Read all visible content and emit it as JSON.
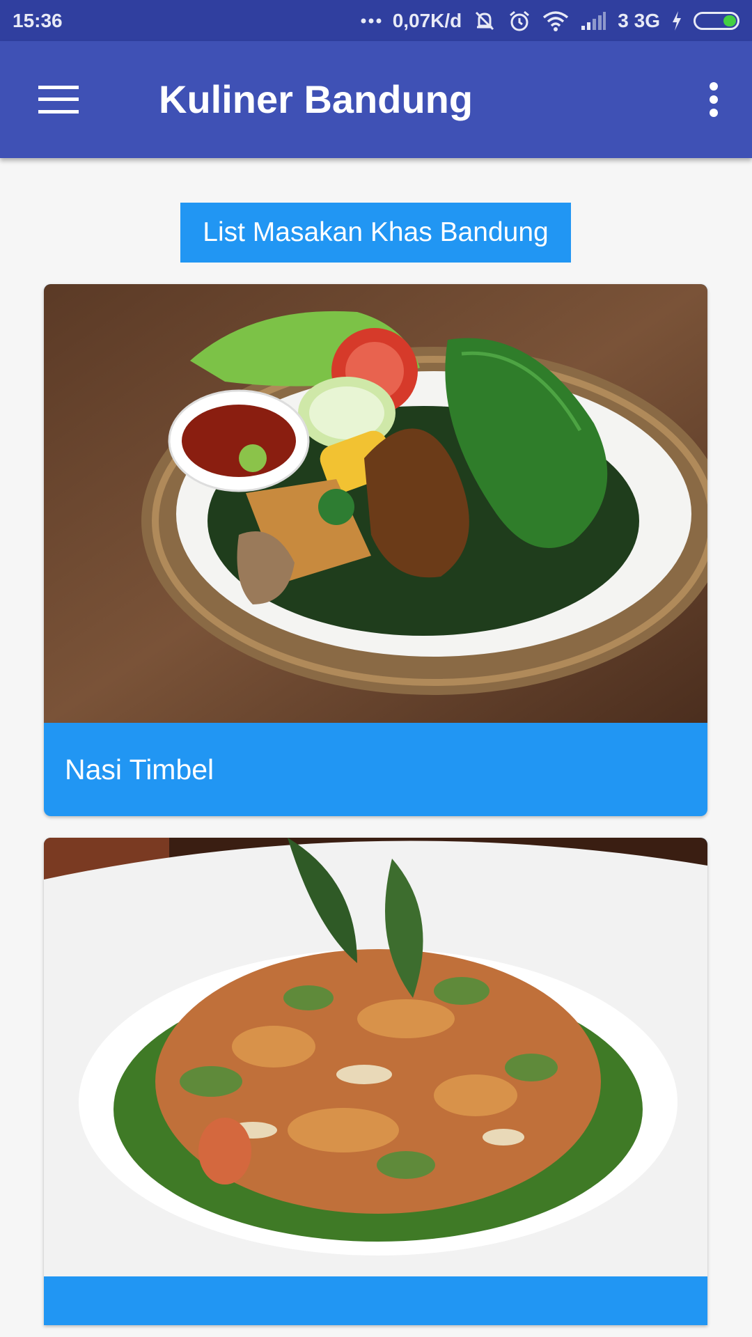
{
  "status_bar": {
    "time": "15:36",
    "speed": "0,07K/d",
    "network": "3 3G",
    "icons": [
      "dots-icon",
      "mute-icon",
      "alarm-icon",
      "wifi-icon",
      "signal-icon",
      "charging-icon",
      "battery-icon"
    ]
  },
  "app_bar": {
    "title": "Kuliner Bandung",
    "menu_icon": "hamburger-menu-icon",
    "more_icon": "more-vert-icon"
  },
  "list_button_label": "List Masakan Khas Bandung",
  "dishes": [
    {
      "name": "Nasi Timbel",
      "image": "nasi-timbel-photo"
    },
    {
      "name": "",
      "image": "karedok-salad-photo"
    }
  ],
  "colors": {
    "status_bar": "#303f9f",
    "app_bar": "#3f51b5",
    "accent": "#2196f3",
    "background": "#f6f6f6"
  }
}
